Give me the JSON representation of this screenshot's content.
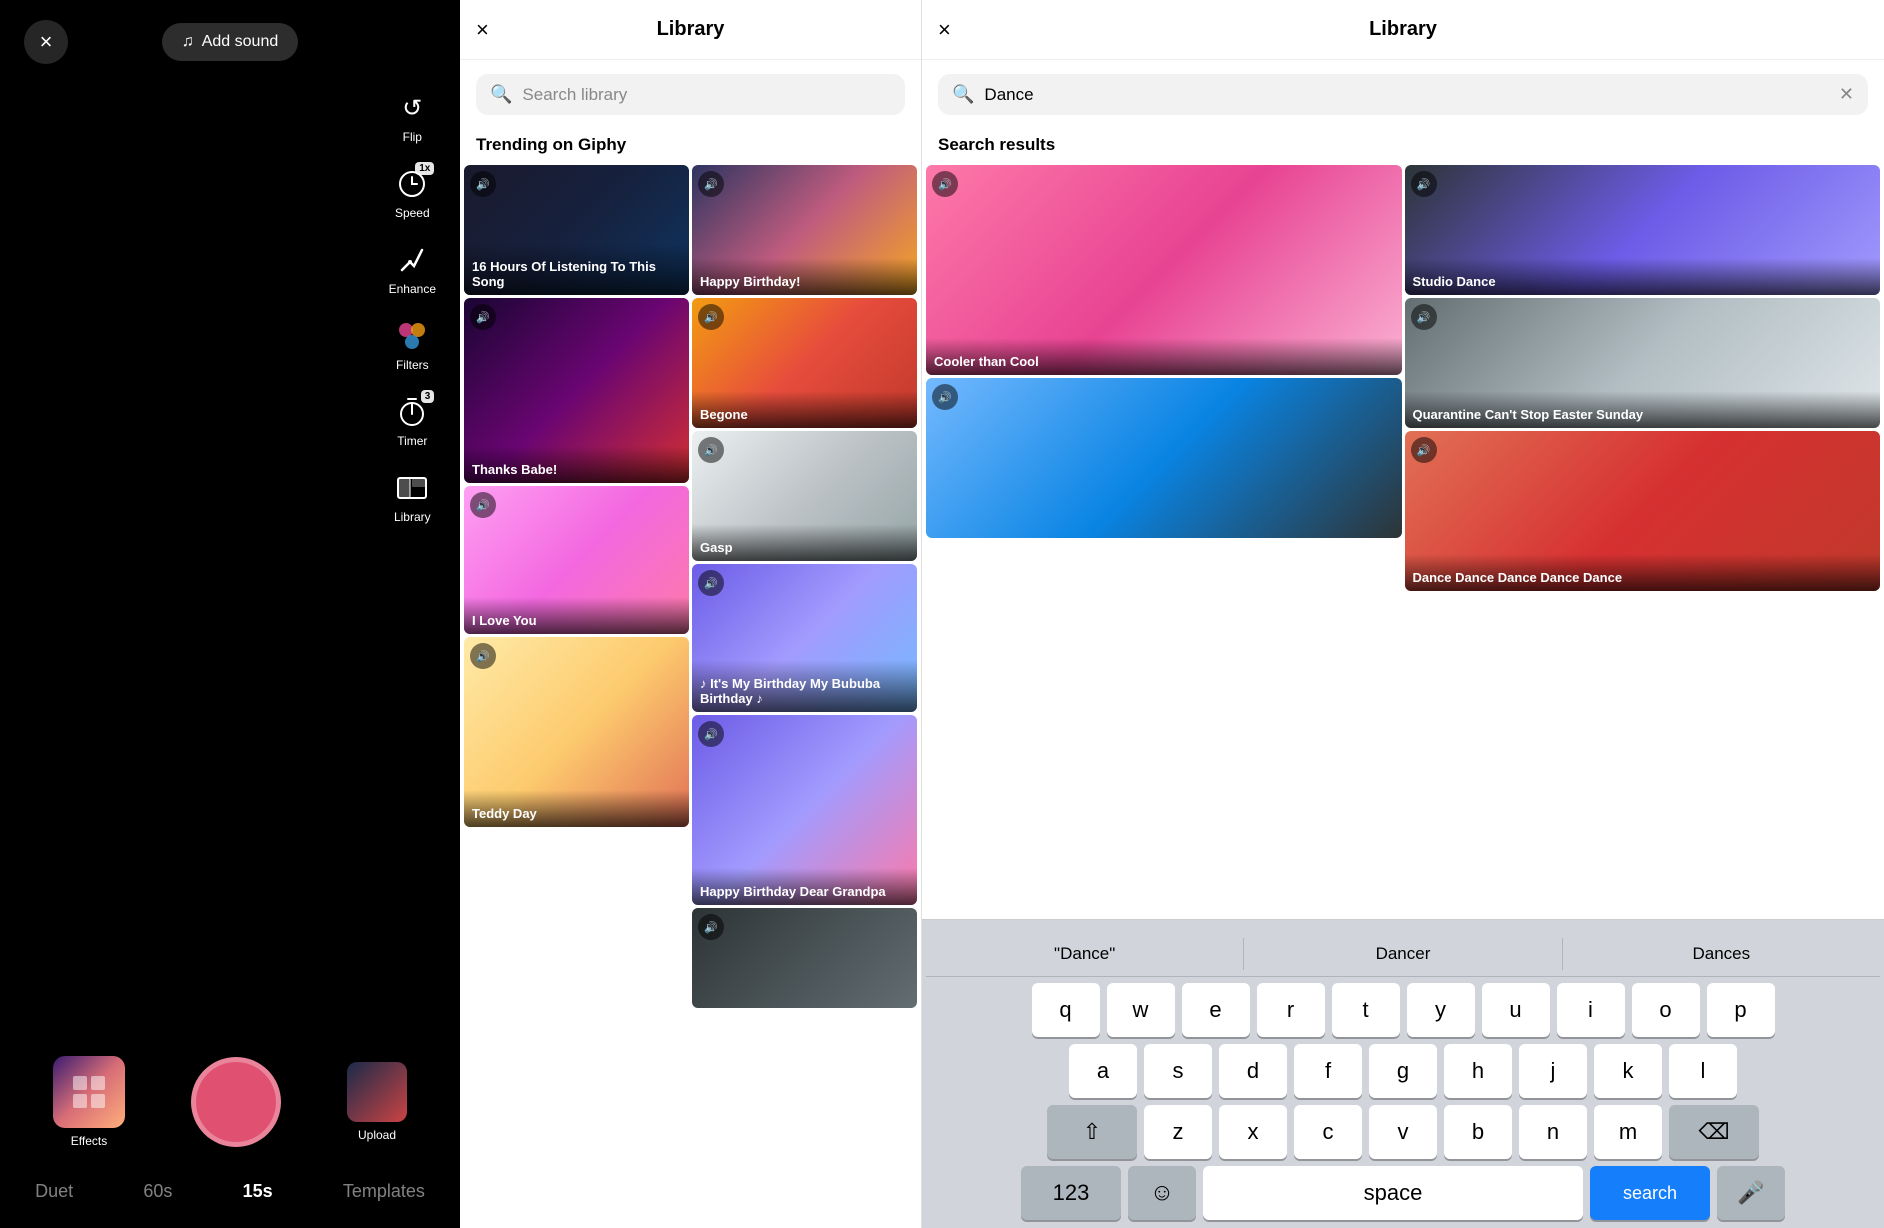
{
  "left": {
    "close_label": "×",
    "add_sound_label": "Add sound",
    "tools": [
      {
        "id": "flip",
        "icon": "↺",
        "label": "Flip"
      },
      {
        "id": "speed",
        "icon": "⚡",
        "label": "Speed"
      },
      {
        "id": "enhance",
        "icon": "✨",
        "label": "Enhance"
      },
      {
        "id": "filters",
        "icon": "⊕",
        "label": "Filters"
      },
      {
        "id": "timer",
        "icon": "⏱",
        "label": "Timer",
        "badge": "3"
      },
      {
        "id": "library",
        "icon": "🎞",
        "label": "Library"
      }
    ],
    "bottom_tabs": [
      {
        "label": "Duet",
        "active": false
      },
      {
        "label": "60s",
        "active": false
      },
      {
        "label": "15s",
        "active": true
      },
      {
        "label": "Templates",
        "active": false
      }
    ],
    "effects_label": "Effects",
    "upload_label": "Upload"
  },
  "middle_library": {
    "title": "Library",
    "close_label": "×",
    "search_placeholder": "Search library",
    "trending_label": "Trending on Giphy",
    "gifs": [
      {
        "id": "jojo",
        "label": "16 Hours Of Listening To This Song",
        "has_sound": true
      },
      {
        "id": "birthday",
        "label": "Happy Birthday!",
        "has_sound": true
      },
      {
        "id": "thanks",
        "label": "Thanks Babe!",
        "has_sound": true
      },
      {
        "id": "begone",
        "label": "Begone",
        "has_sound": true
      },
      {
        "id": "gasp",
        "label": "Gasp",
        "has_sound": true
      },
      {
        "id": "love",
        "label": "I Love You",
        "has_sound": true
      },
      {
        "id": "bday2",
        "label": "♪ It's My Birthday My Bububa Birthday ♪",
        "has_sound": true
      },
      {
        "id": "teddy",
        "label": "Teddy Day",
        "has_sound": true
      },
      {
        "id": "grandpa",
        "label": "Happy Birthday Dear Grandpa",
        "has_sound": true
      },
      {
        "id": "thank",
        "label": "",
        "has_sound": true
      }
    ]
  },
  "right_library": {
    "title": "Library",
    "close_label": "×",
    "search_value": "Dance",
    "results_label": "Search results",
    "results": [
      {
        "id": "cooler",
        "label": "Cooler than Cool",
        "has_sound": true
      },
      {
        "id": "studio",
        "label": "Studio Dance",
        "has_sound": true
      },
      {
        "id": "quarantine",
        "label": "Quarantine Can't Stop Easter Sunday",
        "has_sound": true
      },
      {
        "id": "dancing",
        "label": "",
        "has_sound": true
      },
      {
        "id": "dance2",
        "label": "Dance Dance Dance Dance Dance",
        "has_sound": true
      }
    ],
    "keyboard": {
      "suggestions": [
        "\"Dance\"",
        "Dancer",
        "Dances"
      ],
      "row1": [
        "q",
        "w",
        "e",
        "r",
        "t",
        "y",
        "u",
        "i",
        "o",
        "p"
      ],
      "row2": [
        "a",
        "s",
        "d",
        "f",
        "g",
        "h",
        "j",
        "k",
        "l"
      ],
      "row3": [
        "z",
        "x",
        "c",
        "v",
        "b",
        "n",
        "m"
      ],
      "space_label": "space",
      "search_label": "search",
      "numbers_label": "123"
    }
  }
}
